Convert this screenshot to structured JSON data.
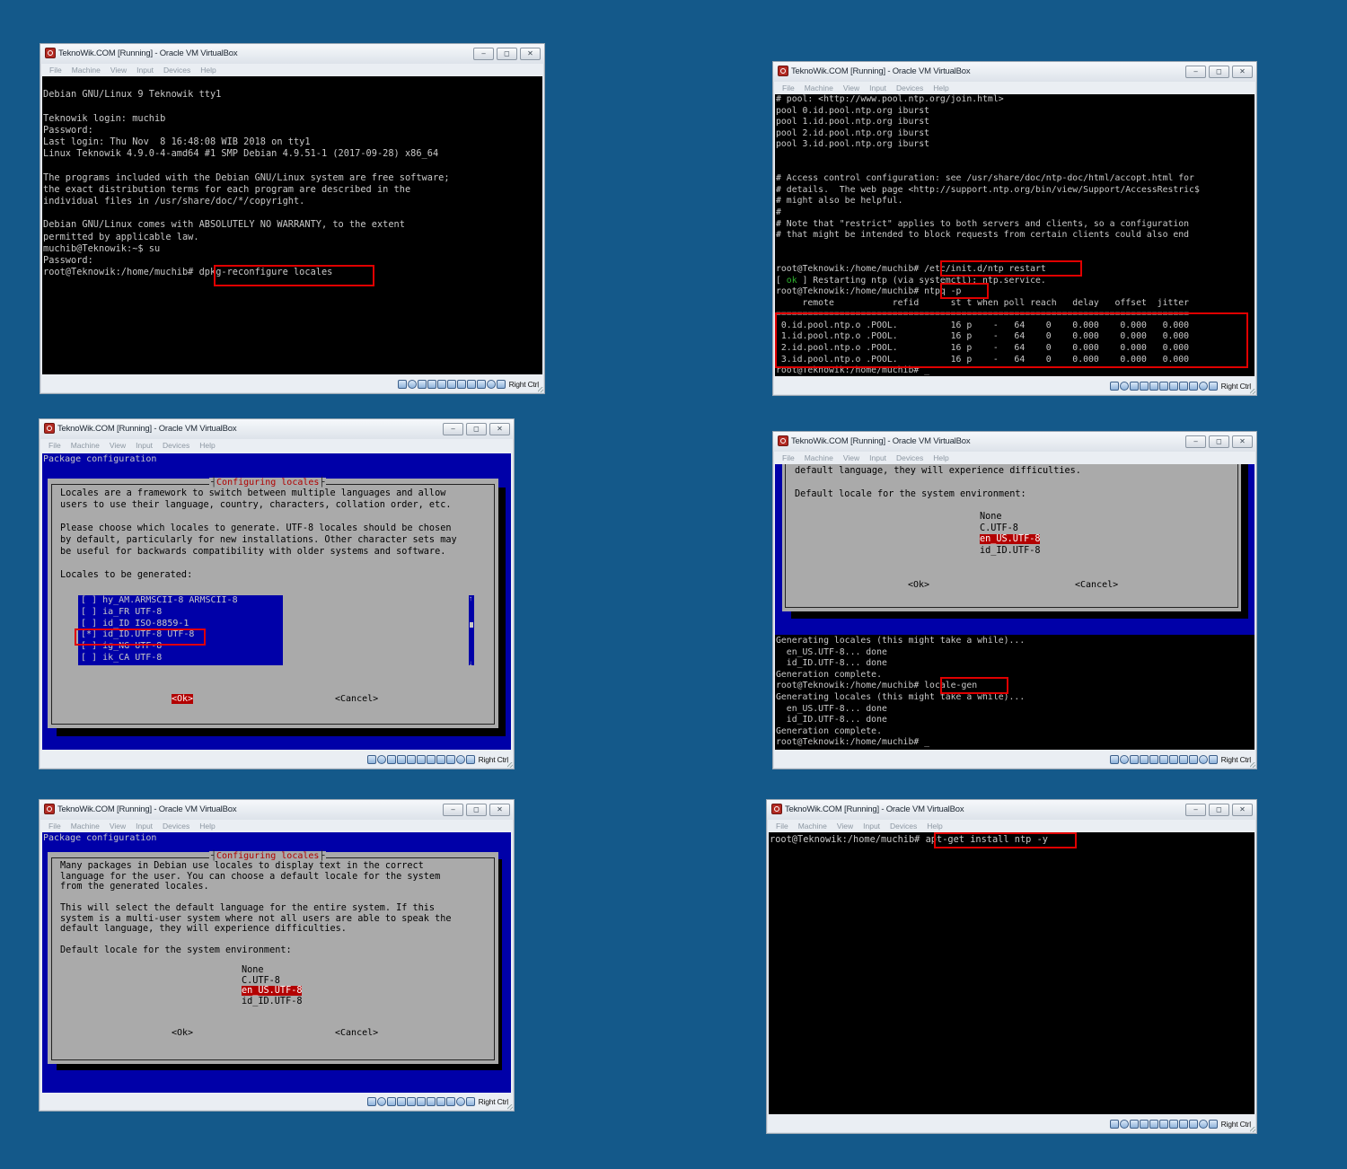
{
  "app": {
    "window_title": "TeknoWik.COM [Running] - Oracle VM VirtualBox",
    "menu": [
      "File",
      "Machine",
      "View",
      "Input",
      "Devices",
      "Help"
    ],
    "host_key": "Right Ctrl",
    "controls": {
      "minimize": "‒",
      "restore": "◻",
      "close": "✕"
    }
  },
  "win1": {
    "lines": [
      "",
      "Debian GNU/Linux 9 Teknowik tty1",
      "",
      "Teknowik login: muchib",
      "Password:",
      "Last login: Thu Nov  8 16:48:08 WIB 2018 on tty1",
      "Linux Teknowik 4.9.0-4-amd64 #1 SMP Debian 4.9.51-1 (2017-09-28) x86_64",
      "",
      "The programs included with the Debian GNU/Linux system are free software;",
      "the exact distribution terms for each program are described in the",
      "individual files in /usr/share/doc/*/copyright.",
      "",
      "Debian GNU/Linux comes with ABSOLUTELY NO WARRANTY, to the extent",
      "permitted by applicable law.",
      "muchib@Teknowik:~$ su",
      "Password:"
    ],
    "prompt": "root@Teknowik:/home/muchib# ",
    "command": "dpkg-reconfigure locales"
  },
  "win2": {
    "lines": [
      "# pool: <http://www.pool.ntp.org/join.html>",
      "pool 0.id.pool.ntp.org iburst",
      "pool 1.id.pool.ntp.org iburst",
      "pool 2.id.pool.ntp.org iburst",
      "pool 3.id.pool.ntp.org iburst",
      "",
      "",
      "# Access control configuration: see /usr/share/doc/ntp-doc/html/accopt.html for",
      "# details.  The web page <http://support.ntp.org/bin/view/Support/AccessRestric$",
      "# might also be helpful.",
      "#",
      "# Note that \"restrict\" applies to both servers and clients, so a configuration",
      "# that might be intended to block requests from certain clients could also end",
      "",
      ""
    ],
    "prompt": "root@Teknowik:/home/muchib# ",
    "cmd_restart": "/etc/init.d/ntp restart",
    "ok_open": "[ ",
    "ok_word": "ok",
    "ok_rest": " ] Restarting ntp (via systemctl): ntp.service.",
    "cmd_ntpq": "ntpq -p",
    "ntpq_header": "     remote           refid      st t when poll reach   delay   offset  jitter",
    "ntpq_sep": "==============================================================================",
    "ntpq_rows": [
      " 0.id.pool.ntp.o .POOL.          16 p    -   64    0    0.000    0.000   0.000",
      " 1.id.pool.ntp.o .POOL.          16 p    -   64    0    0.000    0.000   0.000",
      " 2.id.pool.ntp.o .POOL.          16 p    -   64    0    0.000    0.000   0.000",
      " 3.id.pool.ntp.o .POOL.          16 p    -   64    0    0.000    0.000   0.000"
    ],
    "last_line": "root@Teknowik:/home/muchib# _"
  },
  "win3": {
    "pkg_title": "Package configuration",
    "dialog_title": "Configuring locales",
    "text": [
      "Locales are a framework to switch between multiple languages and allow",
      "users to use their language, country, characters, collation order, etc.",
      "",
      "Please choose which locales to generate. UTF-8 locales should be chosen",
      "by default, particularly for new installations. Other character sets may",
      "be useful for backwards compatibility with older systems and software.",
      "",
      "Locales to be generated:"
    ],
    "locales": [
      "[ ] hy_AM.ARMSCII-8 ARMSCII-8",
      "[ ] ia_FR UTF-8",
      "[ ] id_ID ISO-8859-1",
      "[*] id_ID.UTF-8 UTF-8",
      "[ ] ig_NG UTF-8",
      "[ ] ik_CA UTF-8"
    ],
    "scroll_arrows": {
      "up": "↑",
      "down": "↓"
    },
    "ok": "<Ok>",
    "cancel": "<Cancel>"
  },
  "win4": {
    "dialog_lines": [
      "default language, they will experience difficulties.",
      "",
      "Default locale for the system environment:"
    ],
    "options": [
      "None",
      "C.UTF-8",
      "en_US.UTF-8",
      "id_ID.UTF-8"
    ],
    "selected_option": "en_US.UTF-8",
    "ok": "<Ok>",
    "cancel": "<Cancel>",
    "lines_a": [
      "Generating locales (this might take a while)...",
      "  en_US.UTF-8... done",
      "  id_ID.UTF-8... done",
      "Generation complete."
    ],
    "prompt": "root@Teknowik:/home/muchib# ",
    "command": "locale-gen",
    "lines_b": [
      "Generating locales (this might take a while)...",
      "  en_US.UTF-8... done",
      "  id_ID.UTF-8... done",
      "Generation complete.",
      "root@Teknowik:/home/muchib# _"
    ]
  },
  "win5": {
    "pkg_title": "Package configuration",
    "dialog_title": "Configuring locales",
    "text": [
      "Many packages in Debian use locales to display text in the correct",
      "language for the user. You can choose a default locale for the system",
      "from the generated locales.",
      "",
      "This will select the default language for the entire system. If this",
      "system is a multi-user system where not all users are able to speak the",
      "default language, they will experience difficulties.",
      "",
      "Default locale for the system environment:"
    ],
    "options": [
      "None",
      "C.UTF-8",
      "en_US.UTF-8",
      "id_ID.UTF-8"
    ],
    "selected_option": "en_US.UTF-8",
    "ok": "<Ok>",
    "cancel": "<Cancel>"
  },
  "win6": {
    "prompt": "root@Teknowik:/home/muchib# ",
    "command": "apt-get install ntp -y"
  }
}
